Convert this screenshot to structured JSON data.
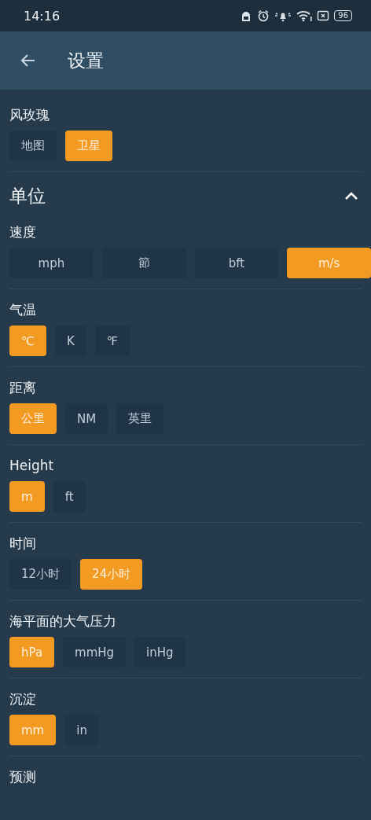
{
  "status_bar": {
    "time": "14:16",
    "battery": "96"
  },
  "app_bar": {
    "title": "设置"
  },
  "wind_rose": {
    "label": "风玫瑰",
    "kind": "chips",
    "options": [
      {
        "label": "地图",
        "selected": false
      },
      {
        "label": "卫星",
        "selected": true
      }
    ]
  },
  "units": {
    "title": "单位",
    "expanded": true,
    "groups": [
      {
        "label": "速度",
        "kind": "wide",
        "options": [
          {
            "label": "mph",
            "selected": false
          },
          {
            "label": "節",
            "selected": false
          },
          {
            "label": "bft",
            "selected": false
          },
          {
            "label": "m/s",
            "selected": true
          }
        ]
      },
      {
        "label": "气温",
        "kind": "chips",
        "options": [
          {
            "label": "℃",
            "selected": true
          },
          {
            "label": "K",
            "selected": false
          },
          {
            "label": "℉",
            "selected": false
          }
        ]
      },
      {
        "label": "距离",
        "kind": "chips",
        "options": [
          {
            "label": "公里",
            "selected": true
          },
          {
            "label": "NM",
            "selected": false
          },
          {
            "label": "英里",
            "selected": false
          }
        ]
      },
      {
        "label": "Height",
        "kind": "chips",
        "options": [
          {
            "label": "m",
            "selected": true
          },
          {
            "label": "ft",
            "selected": false
          }
        ]
      },
      {
        "label": "时间",
        "kind": "chips",
        "options": [
          {
            "label": "12小时",
            "selected": false
          },
          {
            "label": "24小时",
            "selected": true
          }
        ]
      },
      {
        "label": "海平面的大气压力",
        "kind": "chips",
        "options": [
          {
            "label": "hPa",
            "selected": true
          },
          {
            "label": "mmHg",
            "selected": false
          },
          {
            "label": "inHg",
            "selected": false
          }
        ]
      },
      {
        "label": "沉淀",
        "kind": "chips",
        "options": [
          {
            "label": "mm",
            "selected": true
          },
          {
            "label": "in",
            "selected": false
          }
        ]
      },
      {
        "label": "预测"
      }
    ]
  }
}
